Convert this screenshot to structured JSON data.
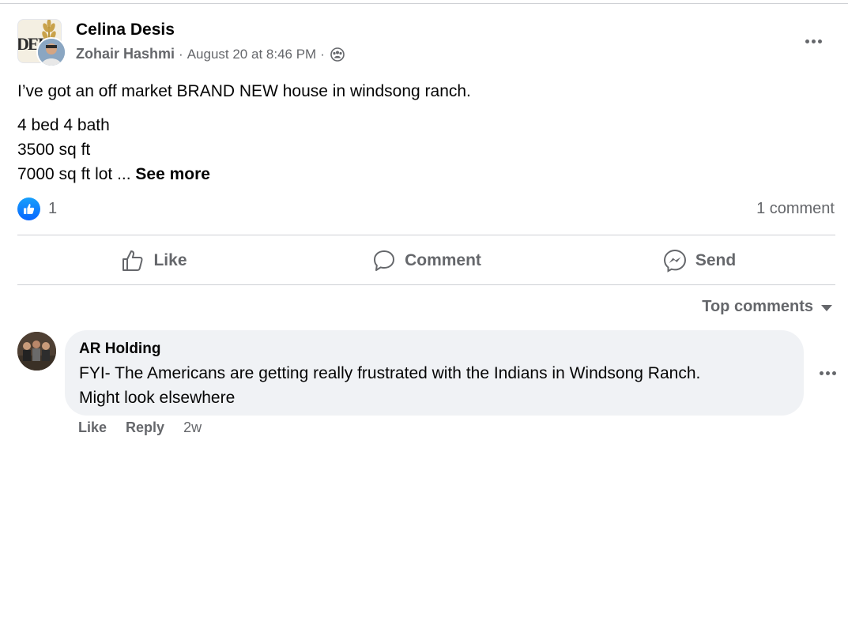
{
  "post": {
    "group_name": "Celina Desis",
    "author": "Zohair Hashmi",
    "separator": "·",
    "timestamp": "August 20 at 8:46 PM",
    "privacy_icon": "group-members-icon",
    "text_lines": [
      "I’ve got an off market BRAND NEW house in windsong ranch.",
      "4 bed 4 bath",
      "3500 sq ft",
      "7000 sq ft lot ... "
    ],
    "see_more": "See more",
    "reaction_icon": "like-reaction-icon",
    "reaction_count": "1",
    "comment_count": "1 comment",
    "group_logo_text": "DEI"
  },
  "actions": {
    "like": "Like",
    "comment": "Comment",
    "send": "Send"
  },
  "comments": {
    "sort_label": "Top comments",
    "items": [
      {
        "author": "AR Holding",
        "text_line1": "FYI- The Americans are getting really frustrated with the Indians in Windsong Ranch.",
        "text_line2": "Might look elsewhere",
        "like": "Like",
        "reply": "Reply",
        "age": "2w"
      }
    ]
  },
  "colors": {
    "accent": "#0866ff",
    "secondary_text": "#65676b",
    "bubble_bg": "#f0f2f5",
    "divider": "#ced0d4"
  }
}
